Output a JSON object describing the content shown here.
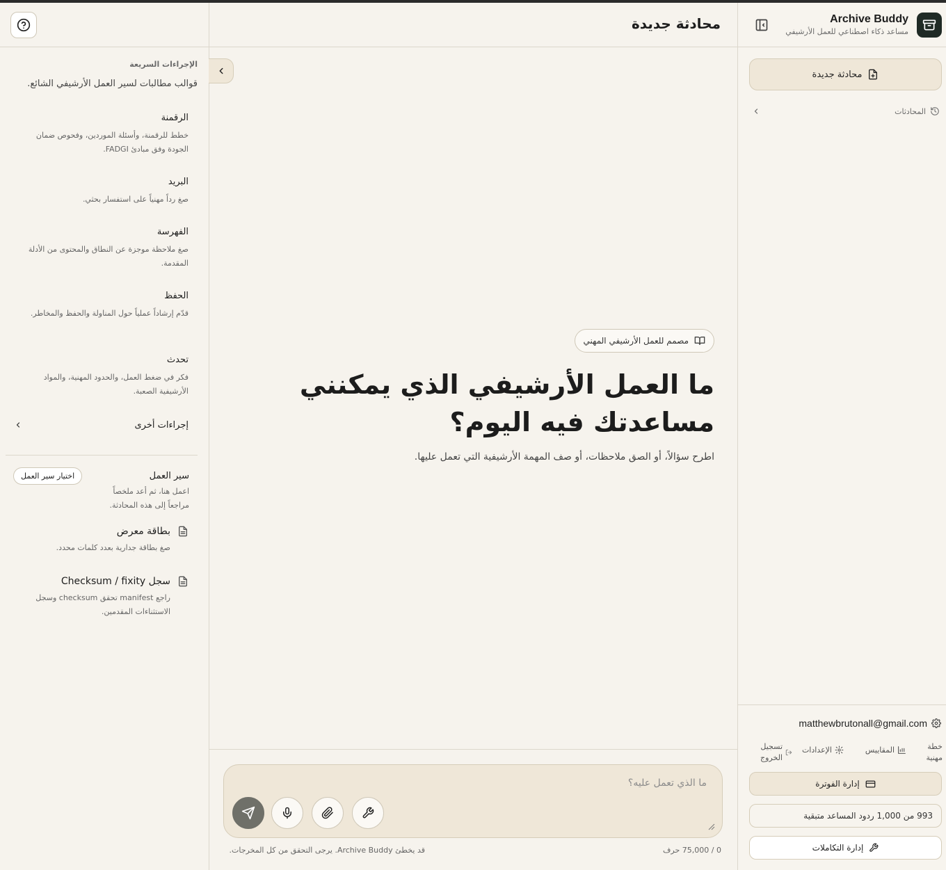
{
  "app": {
    "name": "Archive Buddy",
    "tagline": "مساعد ذكاء اصطناعي للعمل الأرشيفي"
  },
  "sidebar": {
    "new_chat_label": "محادثة جديدة",
    "conversations_label": "المحادثات",
    "user_email": "matthewbrutonall@gmail.com",
    "links": {
      "plan": "خطة مهنية",
      "metrics": "المقاييس",
      "settings": "الإعدادات",
      "logout": "تسجيل الخروج"
    },
    "billing_label": "إدارة الفوترة",
    "quota_text": "993 من 1,000 ردود المساعد متبقية",
    "integrations_label": "إدارة التكاملات"
  },
  "main": {
    "title": "محادثة جديدة",
    "badge": "مصمم للعمل الأرشيفي المهني",
    "hero_line1": "ما العمل الأرشيفي الذي يمكنني",
    "hero_line2": "مساعدتك فيه اليوم؟",
    "hero_sub": "اطرح سؤالاً، أو الصق ملاحظات، أو صف المهمة الأرشيفية التي تعمل عليها.",
    "composer_placeholder": "ما الذي تعمل عليه؟",
    "char_count": "0 / 75,000 حرف",
    "disclaimer": "قد يخطئ Archive Buddy. يرجى التحقق من كل المخرجات."
  },
  "quick_actions": {
    "title": "الإجراءات السريعة",
    "subtitle": "قوالب مطالبات لسير العمل الأرشيفي الشائع.",
    "items": [
      {
        "title": "الرقمنة",
        "desc": "خطط للرقمنة، وأسئلة الموردين، وفحوص ضمان الجودة وفق مبادئ FADGI."
      },
      {
        "title": "البريد",
        "desc": "صغ رداً مهنياً على استفسار بحثي."
      },
      {
        "title": "الفهرسة",
        "desc": "صغ ملاحظة موجزة عن النطاق والمحتوى من الأدلة المقدمة."
      },
      {
        "title": "الحفظ",
        "desc": "قدّم إرشاداً عملياً حول المناولة والحفظ والمخاطر."
      },
      {
        "title": "تحدث",
        "desc": "فكر في ضغط العمل، والحدود المهنية، والمواد الأرشيفية الصعبة."
      }
    ],
    "more_label": "إجراءات أخرى"
  },
  "workflow": {
    "title": "سير العمل",
    "desc": "اعمل هنا، ثم أعد ملخصاً مراجعاً إلى هذه المحادثة.",
    "button": "اختيار سير العمل",
    "tools": [
      {
        "title": "بطاقة معرض",
        "desc": "صغ بطاقة جدارية بعدد كلمات محدد."
      },
      {
        "title": "سجل Checksum / fixity",
        "desc": "راجع manifest تحقق checksum وسجل الاستثناءات المقدمين."
      }
    ]
  },
  "colors": {
    "background": "#f6f3ed",
    "accent_fill": "#efe7d8",
    "brand_dark": "#1f2a25",
    "send_button": "#6f7069"
  },
  "icons": {
    "brand": "archive-box-icon",
    "collapse": "sidebar-collapse-icon",
    "new_chat": "file-plus-icon",
    "history": "history-icon",
    "help": "help-circle-icon",
    "send": "send-icon",
    "mic": "microphone-icon",
    "attach": "paperclip-icon",
    "tools": "wrench-icon"
  }
}
